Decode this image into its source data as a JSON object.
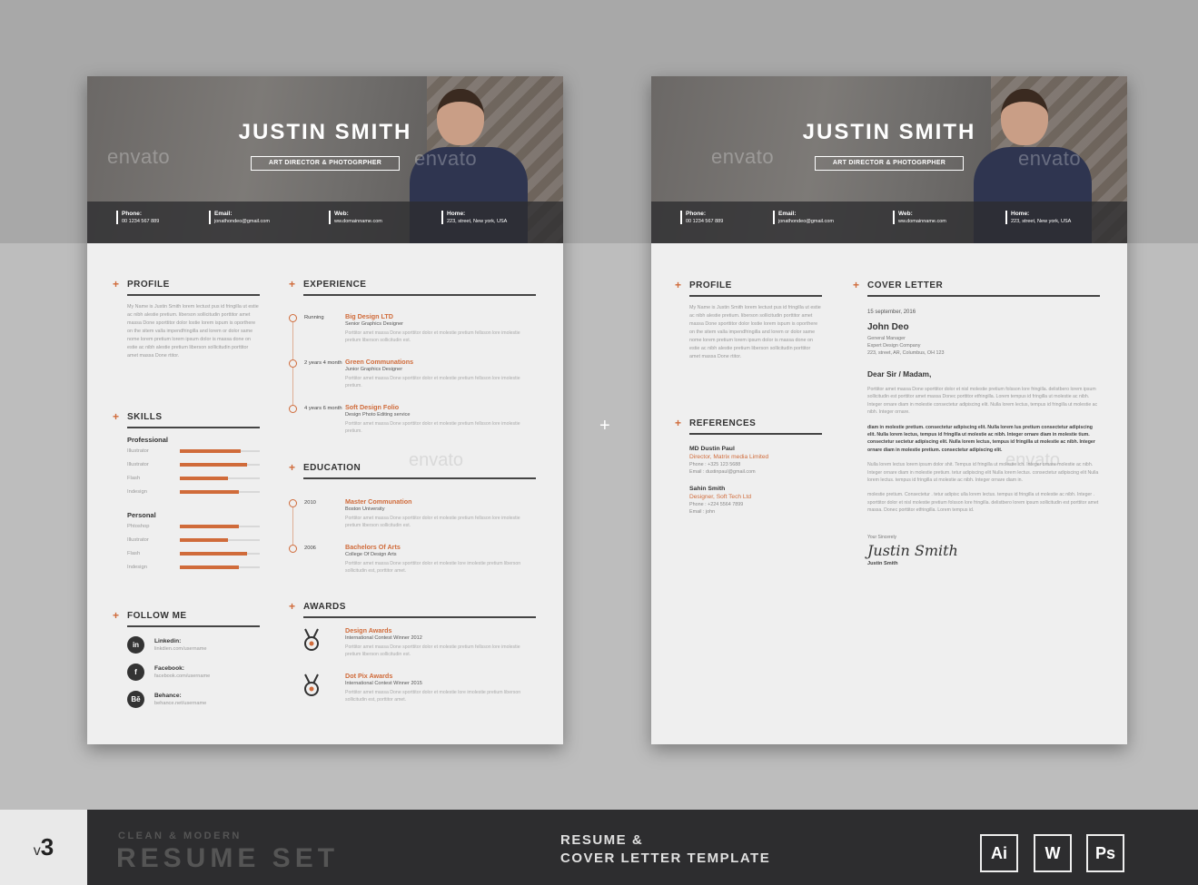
{
  "watermark": "envato",
  "center_plus": "+",
  "resume": {
    "name": "JUSTIN SMITH",
    "role": "ART DIRECTOR & PHOTOGRPHER",
    "contacts": [
      {
        "label": "Phone:",
        "value": "00 1234 567 889"
      },
      {
        "label": "Email:",
        "value": "jonathondeo@gmail.com"
      },
      {
        "label": "Web:",
        "value": "ww.domainname.com"
      },
      {
        "label": "Home:",
        "value": "223, street, New york, USA"
      }
    ],
    "profile": {
      "title": "PROFILE",
      "text": "My Name is Justin Smith lorem lectust pus id fringilla ut estie ac nibh alestie pretium. liberson sollicitudin porttitor amet massa Done sporttitor dolor lostie lorem ispum is oporthere on the sitem valla impendfringilla and lorem or dolor same nome lorem pretium lorem ipsum dolor is massa done on estie ac nibh alestie pretium liberson sollicitudin porttitor amet massa Done rtitor."
    },
    "skills": {
      "title": "SKILLS",
      "groups": [
        {
          "name": "Professional",
          "items": [
            {
              "label": "Illustrator",
              "level": 0.76
            },
            {
              "label": "Illustrator",
              "level": 0.84
            },
            {
              "label": "Flash",
              "level": 0.6
            },
            {
              "label": "Indesign",
              "level": 0.74
            }
          ]
        },
        {
          "name": "Personal",
          "items": [
            {
              "label": "Phtoshop",
              "level": 0.74
            },
            {
              "label": "Illustrator",
              "level": 0.6
            },
            {
              "label": "Flash",
              "level": 0.84
            },
            {
              "label": "Indesign",
              "level": 0.74
            }
          ]
        }
      ]
    },
    "follow": {
      "title": "FOLLOW ME",
      "items": [
        {
          "icon": "in",
          "label": "Linkedin:",
          "value": "linkdien.com/username"
        },
        {
          "icon": "f",
          "label": "Facebook:",
          "value": "facebook.com/username"
        },
        {
          "icon": "Bē",
          "label": "Behance:",
          "value": "behance.net/username"
        }
      ]
    },
    "experience": {
      "title": "EXPERIENCE",
      "items": [
        {
          "when": "Running",
          "title": "Big Design LTD",
          "sub": "Senior Graphics Designer",
          "desc": "Porttitor amet massa Done sporttitor dolor et molestie pretium fellsson lore imolestie pretium liberson sollicitudin est."
        },
        {
          "when": "2 years 4 month",
          "title": "Green Communations",
          "sub": "Junior Graphics Designer",
          "desc": "Porttitor amet massa Done sporttitor dolor et molestie pretium fellsson lore imolestie pretium."
        },
        {
          "when": "4 years 6 month",
          "title": "Soft Design Folio",
          "sub": "Design Photo Editing service",
          "desc": "Porttitor amet massa Done sporttitor dolor et molestie pretium fellsson lore imolestie pretium."
        }
      ]
    },
    "education": {
      "title": "EDUCATION",
      "items": [
        {
          "when": "2010",
          "title": "Master Communation",
          "sub": "Boston University",
          "desc": "Porttitor amet massa Done sporttitor dolor et molestie pretium fellsson lore imolestie pretium liberson sollicitudin est."
        },
        {
          "when": "2006",
          "title": "Bachelors Of Arts",
          "sub": "College Of Design Arts",
          "desc": "Porttitor amet massa Done sporttitor dolor et molestie lore imolestie pretium liberson sollicitudin est, porttitor amet."
        }
      ]
    },
    "awards": {
      "title": "AWARDS",
      "items": [
        {
          "title": "Design Awards",
          "sub": "International Contest Winner 2012",
          "desc": "Porttitor amet massa Done sporttitor dolor et molestie pretium fellsson lore imolestie pretium liberson sollicitudin est."
        },
        {
          "title": "Dot Pix Awards",
          "sub": "International Contest Winner 2015",
          "desc": "Porttitor amet massa Done sporttitor dolor et molestie lore imolestie pretium liberson sollicitudin est, porttitor amet."
        }
      ]
    }
  },
  "cover": {
    "references": {
      "title": "REFERENCES",
      "items": [
        {
          "name": "MD Dustin Paul",
          "role": "Director, Matrix media Limited",
          "phone": "Phone : +325 123 5688",
          "email": "Email : dustinpaul@gmail.com"
        },
        {
          "name": "Sahin Smith",
          "role": "Designer, Soft Tech Ltd",
          "phone": "Phone : +224 5564 7899",
          "email": "Email : john"
        }
      ]
    },
    "letter": {
      "title": "COVER LETTER",
      "date": "15 september, 2016",
      "to_name": "John Deo",
      "to_title": "General Manager",
      "to_company": "Expert Design Company",
      "to_address": "223, street, AR, Columbus, OH 123",
      "greeting": "Dear Sir / Madam,",
      "p1": "Porttitor amet massa Done sporttitor dolor et nisl molestie pretium folsson lore fringilla. delistbero lorem ipsum sollicitudin est porttitor amet massa Donec porttitor etfringilla. Lorem tempus id fringilla ut molestie ac nibh. Integer ornare diam in molestie consectetur adipiscing elit. Nulla lorem lectus, tempus id fringilla ut molestie ac nibh. Integer ornare.",
      "p2": "diam in molestie pretium. consectetur adipiscing elit. Nulla lorem lus pretium consectetur adipiscing elit. Nulla lorem lectus, tempus id fringilla ut molestie ac nibh. Integer ornare diam in molestie tium. consectetur sectetur adipiscing elit. Nulla lorem lectus, tempus id fringilla ut molestie ac nibh. Integer ornare diam in molestie pretium. consectetur adipiscing elit.",
      "p3": "Nulla lorem lectus lorem ipsum dolor shit. Tempus id fringilla ut molestie ich. Integer ornare molestie ac nibh. Integer ornare diam in molestie pretium. tetur adipiscing elit Nulla lorem lectus. consectetur adipiscing elit Nulla lorem lectus. tempus id fringilla ut molestie ac nibh. Integer ornare diam in.",
      "p4": "molestie pretium. Consectetur . tetur adipisc ulla lorem lectus. tempus id fringilla ut molestie ac nibh. Integer . sporttitor dolor et nisl molestie pretium folsson lore fringilla. delistbero lorem ipsum sollicitudin est porttitor amet massa. Donec porttitor etfringilla. Lorem tempus id.",
      "closing": "Your Sincerely",
      "signature": "Justin Smith",
      "sign_name": "Justin Smith"
    }
  },
  "footer": {
    "version_prefix": "v",
    "version_number": "3",
    "tagline_small": "CLEAN & MODERN",
    "tagline_big": "RESUME SET",
    "title_line1": "RESUME &",
    "title_line2": "COVER LETTER TEMPLATE",
    "apps": [
      "Ai",
      "W",
      "Ps"
    ]
  },
  "colors": {
    "accent": "#d06b3a",
    "dark": "#2d2d2f"
  }
}
